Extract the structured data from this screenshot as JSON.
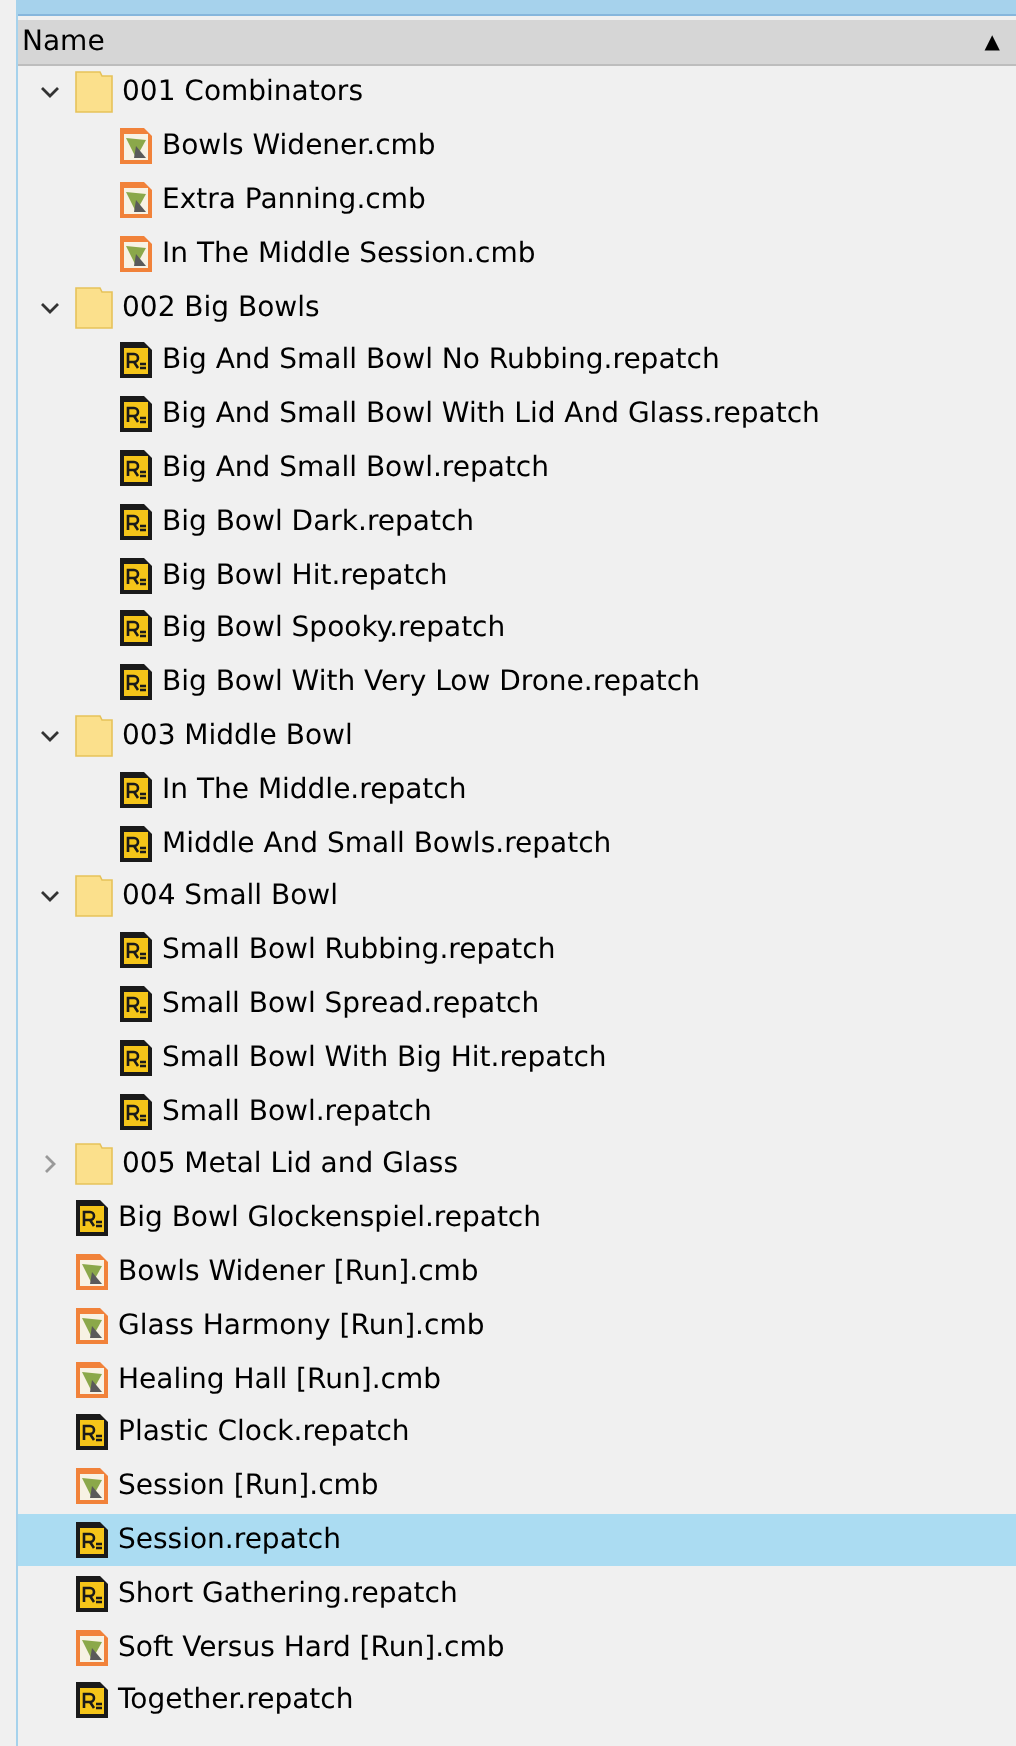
{
  "header": {
    "label": "Name",
    "sort_indicator": "▲"
  },
  "items": [
    {
      "kind": "folder",
      "name": "001 Combinators",
      "expanded": true,
      "selected": false,
      "children": [
        {
          "kind": "combinator",
          "name": "Bowls Widener.cmb",
          "selected": false
        },
        {
          "kind": "combinator",
          "name": "Extra Panning.cmb",
          "selected": false
        },
        {
          "kind": "combinator",
          "name": "In The Middle Session.cmb",
          "selected": false
        }
      ]
    },
    {
      "kind": "folder",
      "name": "002 Big Bowls",
      "expanded": true,
      "selected": false,
      "children": [
        {
          "kind": "patch",
          "name": "Big And Small Bowl No Rubbing.repatch",
          "selected": false
        },
        {
          "kind": "patch",
          "name": "Big And Small Bowl With Lid And Glass.repatch",
          "selected": false
        },
        {
          "kind": "patch",
          "name": "Big And Small Bowl.repatch",
          "selected": false
        },
        {
          "kind": "patch",
          "name": "Big Bowl Dark.repatch",
          "selected": false
        },
        {
          "kind": "patch",
          "name": "Big Bowl Hit.repatch",
          "selected": false
        },
        {
          "kind": "patch",
          "name": "Big Bowl Spooky.repatch",
          "selected": false
        },
        {
          "kind": "patch",
          "name": "Big Bowl With Very Low Drone.repatch",
          "selected": false
        }
      ]
    },
    {
      "kind": "folder",
      "name": "003 Middle Bowl",
      "expanded": true,
      "selected": false,
      "children": [
        {
          "kind": "patch",
          "name": "In The Middle.repatch",
          "selected": false
        },
        {
          "kind": "patch",
          "name": "Middle And Small Bowls.repatch",
          "selected": false
        }
      ]
    },
    {
      "kind": "folder",
      "name": "004 Small Bowl",
      "expanded": true,
      "selected": false,
      "children": [
        {
          "kind": "patch",
          "name": "Small Bowl Rubbing.repatch",
          "selected": false
        },
        {
          "kind": "patch",
          "name": "Small Bowl Spread.repatch",
          "selected": false
        },
        {
          "kind": "patch",
          "name": "Small Bowl With Big Hit.repatch",
          "selected": false
        },
        {
          "kind": "patch",
          "name": "Small Bowl.repatch",
          "selected": false
        }
      ]
    },
    {
      "kind": "folder",
      "name": "005 Metal Lid and Glass",
      "expanded": false,
      "selected": false
    },
    {
      "kind": "patch",
      "name": "Big Bowl Glockenspiel.repatch",
      "selected": false
    },
    {
      "kind": "combinator",
      "name": "Bowls Widener [Run].cmb",
      "selected": false
    },
    {
      "kind": "combinator",
      "name": "Glass Harmony [Run].cmb",
      "selected": false
    },
    {
      "kind": "combinator",
      "name": "Healing Hall [Run].cmb",
      "selected": false
    },
    {
      "kind": "patch",
      "name": "Plastic Clock.repatch",
      "selected": false
    },
    {
      "kind": "combinator",
      "name": "Session [Run].cmb",
      "selected": false
    },
    {
      "kind": "patch",
      "name": "Session.repatch",
      "selected": true
    },
    {
      "kind": "patch",
      "name": "Short Gathering.repatch",
      "selected": false
    },
    {
      "kind": "combinator",
      "name": "Soft Versus Hard [Run].cmb",
      "selected": false
    },
    {
      "kind": "patch",
      "name": "Together.repatch",
      "selected": false
    }
  ]
}
